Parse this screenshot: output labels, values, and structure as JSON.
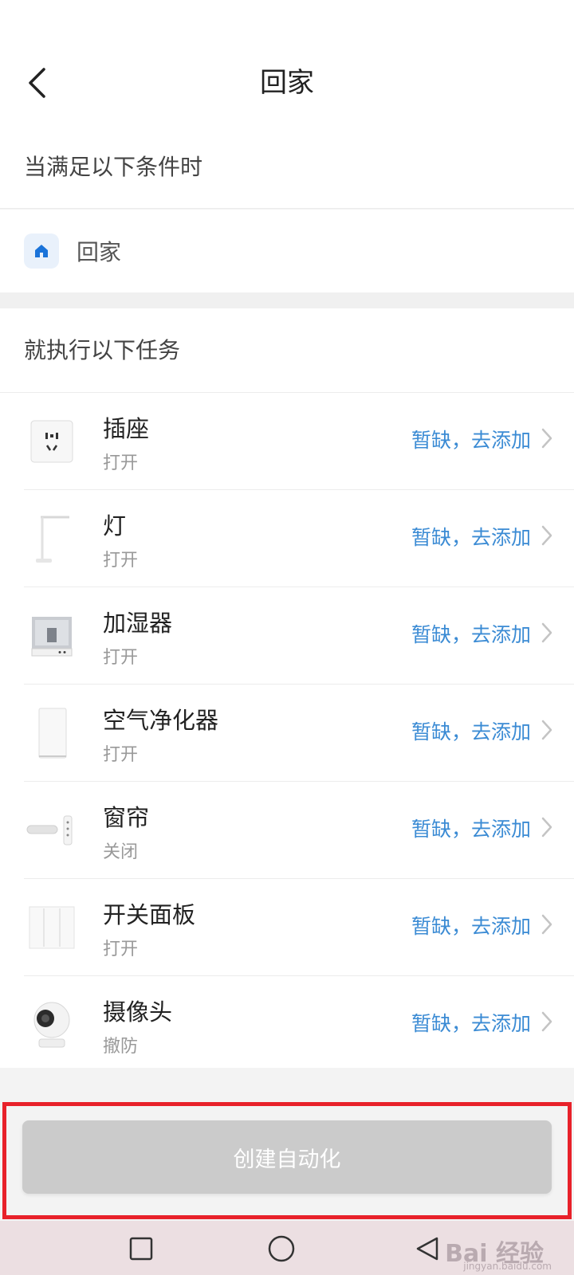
{
  "header": {
    "title": "回家"
  },
  "conditions": {
    "section_title": "当满足以下条件时",
    "item_label": "回家"
  },
  "tasks": {
    "section_title": "就执行以下任务",
    "items": [
      {
        "name": "插座",
        "action": "打开",
        "link": "暂缺，去添加",
        "icon": "socket-icon"
      },
      {
        "name": "灯",
        "action": "打开",
        "link": "暂缺，去添加",
        "icon": "lamp-icon"
      },
      {
        "name": "加湿器",
        "action": "打开",
        "link": "暂缺，去添加",
        "icon": "humidifier-icon"
      },
      {
        "name": "空气净化器",
        "action": "打开",
        "link": "暂缺，去添加",
        "icon": "air-purifier-icon"
      },
      {
        "name": "窗帘",
        "action": "关闭",
        "link": "暂缺，去添加",
        "icon": "curtain-icon"
      },
      {
        "name": "开关面板",
        "action": "打开",
        "link": "暂缺，去添加",
        "icon": "switch-panel-icon"
      },
      {
        "name": "摄像头",
        "action": "撤防",
        "link": "暂缺，去添加",
        "icon": "camera-icon"
      }
    ]
  },
  "footer": {
    "create_button": "创建自动化"
  },
  "watermark": {
    "main": "Bai 经验",
    "sub": "jingyan.baidu.com"
  },
  "colors": {
    "link": "#3b8bd4",
    "highlight_frame": "#e8212a",
    "button_disabled": "#cbcbcb"
  }
}
